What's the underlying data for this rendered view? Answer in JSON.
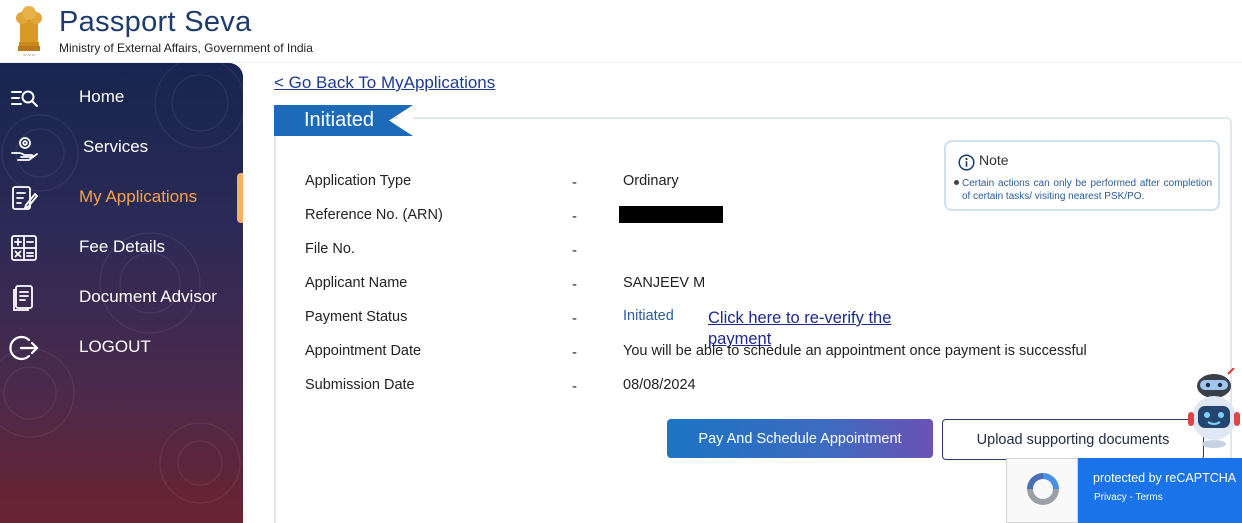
{
  "header": {
    "title": "Passport Seva",
    "subtitle": "Ministry of External Affairs, Government of India"
  },
  "sidebar": {
    "items": [
      {
        "label": "Home",
        "icon": "search-menu-icon",
        "active": false
      },
      {
        "label": "Services",
        "icon": "services-hand-icon",
        "active": false
      },
      {
        "label": "My Applications",
        "icon": "applications-icon",
        "active": true
      },
      {
        "label": "Fee Details",
        "icon": "calculator-icon",
        "active": false
      },
      {
        "label": "Document Advisor",
        "icon": "document-icon",
        "active": false
      },
      {
        "label": "LOGOUT",
        "icon": "logout-icon",
        "active": false
      }
    ]
  },
  "main": {
    "back_link": "< Go Back To MyApplications",
    "status_tag": "Initiated",
    "separator": "-",
    "fields": [
      {
        "label": "Application Type",
        "value": "Ordinary"
      },
      {
        "label": "Reference No. (ARN)",
        "value": ""
      },
      {
        "label": "File No.",
        "value": ""
      },
      {
        "label": "Applicant Name",
        "value": "SANJEEV M"
      },
      {
        "label": "Payment Status",
        "value": "Initiated"
      },
      {
        "label": "Appointment Date",
        "value": "You will be able to schedule an appointment once payment is successful"
      },
      {
        "label": "Submission Date",
        "value": "08/08/2024"
      }
    ],
    "reverify_link": "Click here to re-verify the payment",
    "note": {
      "title": "Note",
      "text": "Certain actions can only be performed after completion of certain tasks/ visiting nearest PSK/PO."
    },
    "buttons": {
      "pay": "Pay And Schedule Appointment",
      "upload": "Upload supporting documents"
    }
  },
  "recaptcha": {
    "text": "protected by reCAPTCHA",
    "links": "Privacy - Terms"
  },
  "colors": {
    "brand": "#1d3b6e",
    "active_nav": "#f6a24c",
    "tag_blue": "#1c6ab8",
    "link": "#1d2a8a"
  }
}
